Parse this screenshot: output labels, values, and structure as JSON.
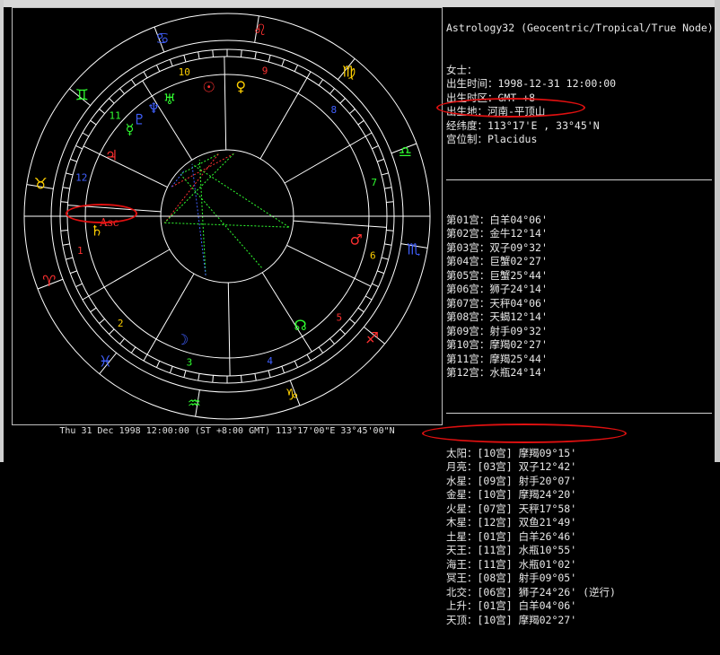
{
  "footer": "Thu 31 Dec 1998 12:00:00 (ST +8:00 GMT) 113°17'00\"E 33°45'00\"N",
  "header": {
    "title": "Astrology32 (Geocentric/Tropical/True Node)",
    "lines": [
      "女士：",
      "出生时间：1998-12-31 12:00:00",
      "出生时区：GMT +8",
      "出生地：河南-平顶山",
      "经纬度：113°17'E , 33°45'N",
      "宫位制：Placidus"
    ]
  },
  "houses": [
    "第01宫：白羊04°06'",
    "第02宫：金牛12°14'",
    "第03宫：双子09°32'",
    "第04宫：巨蟹02°27'",
    "第05宫：巨蟹25°44'",
    "第06宫：狮子24°14'",
    "第07宫：天秤04°06'",
    "第08宫：天蝎12°14'",
    "第09宫：射手09°32'",
    "第10宫：摩羯02°27'",
    "第11宫：摩羯25°44'",
    "第12宫：水瓶24°14'"
  ],
  "planets": [
    "太阳：[10宫] 摩羯09°15'",
    "月亮：[03宫] 双子12°42'",
    "水星：[09宫] 射手20°07'",
    "金星：[10宫] 摩羯24°20'",
    "火星：[07宫] 天秤17°58'",
    "木星：[12宫] 双鱼21°49'",
    "土星：[01宫] 白羊26°46'",
    "天王：[11宫] 水瓶10°55'",
    "海王：[11宫] 水瓶01°02'",
    "冥王：[08宫] 射手09°05'",
    "北交：[06宫] 狮子24°26' (逆行)",
    "上升：[01宫] 白羊04°06'",
    "天顶：[10宫] 摩羯02°27'"
  ],
  "wheel": {
    "house_numbers": [
      "1",
      "2",
      "3",
      "4",
      "5",
      "6",
      "7",
      "8",
      "9",
      "10",
      "11",
      "12"
    ],
    "asc_label": "Asc",
    "zodiac_glyphs": [
      "♈",
      "♉",
      "♊",
      "♋",
      "♌",
      "♍",
      "♎",
      "♏",
      "♐",
      "♑",
      "♒",
      "♓"
    ],
    "planet_glyphs": [
      "☉",
      "☽",
      "☿",
      "♀",
      "♂",
      "♃",
      "♄",
      "♅",
      "♆",
      "♇",
      "☊"
    ]
  },
  "colors": {
    "background": "#000000",
    "wheel": "#ffffff",
    "highlight": "#e01010",
    "aries": "#ff3030",
    "taurus": "#ffd000",
    "gemini": "#30ff30",
    "cancer": "#4060ff",
    "leo": "#ff3030",
    "virgo": "#ffd000",
    "libra": "#30ff30",
    "scorpio": "#4060ff",
    "sagittarius": "#ff3030",
    "capricorn": "#ffd000",
    "aquarius": "#30ff30",
    "pisces": "#4060ff"
  }
}
